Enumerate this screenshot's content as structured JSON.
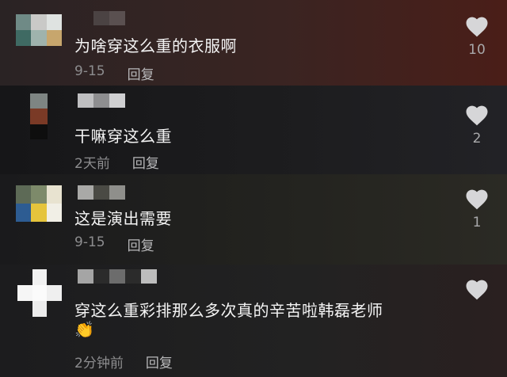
{
  "comments": [
    {
      "text": "为啥穿这么重的衣服啊",
      "time": "9-15",
      "reply": "回复",
      "likes": "10"
    },
    {
      "text": "干嘛穿这么重",
      "time": "2天前",
      "reply": "回复",
      "likes": "2"
    },
    {
      "text": "这是演出需要",
      "time": "9-15",
      "reply": "回复",
      "likes": "1"
    },
    {
      "text": "穿这么重彩排那么多次真的辛苦啦韩磊老师",
      "emoji": "👏",
      "time": "2分钟前",
      "reply": "回复",
      "likes": ""
    }
  ],
  "icons": {
    "like": "heart-icon"
  },
  "colors": {
    "text": "#f4f4f4",
    "meta": "#8d8d8f",
    "heart": "#d6d6d8"
  }
}
